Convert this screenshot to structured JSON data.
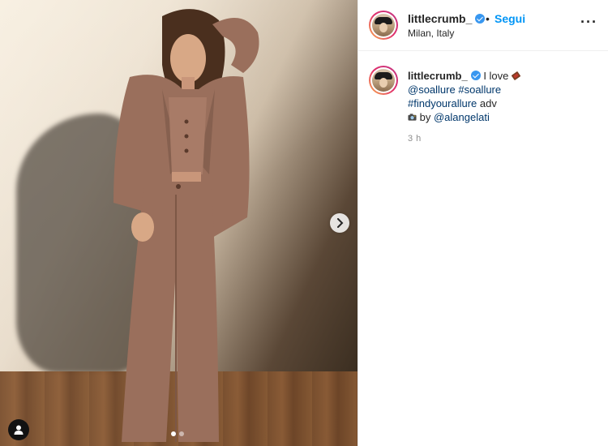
{
  "post": {
    "carousel_total": 2,
    "carousel_active": 1
  },
  "header": {
    "username": "littlecrumb_",
    "separator": "•",
    "follow_label": "Segui",
    "location": "Milan, Italy",
    "more_label": "···"
  },
  "caption": {
    "username": "littlecrumb_",
    "line1_text": "I love",
    "line1_emoji": "chocolate-bar-emoji",
    "tag_soallure_user": "@soallure",
    "tag_soallure_hash": "#soallure",
    "tag_findyourallure": "#findyourallure",
    "adv": "adv",
    "camera_emoji": "camera-emoji",
    "by_label": "by",
    "photographer": "@alangelati",
    "time": "3 h"
  },
  "icons": {
    "next": "chevron-right-icon",
    "user_tag": "user-tag-icon",
    "verified": "verified-badge-icon",
    "more": "more-options-icon"
  },
  "colors": {
    "follow_blue": "#0095f6",
    "verified_blue": "#3897f0",
    "link_dark_blue": "#00376b",
    "suit_color": "#9a6f5c"
  }
}
